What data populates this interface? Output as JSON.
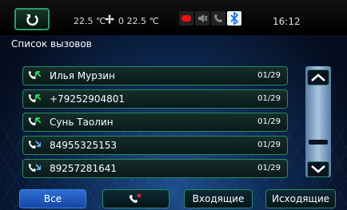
{
  "status": {
    "temp_left": "22.5 ℃",
    "temp_right": "0 22.5 ℃",
    "time": "16:12",
    "icons": [
      "media-icon",
      "mute-icon",
      "phone-status-icon",
      "bluetooth-icon"
    ]
  },
  "title": "Список вызовов",
  "calls": [
    {
      "name": "Илья Мурзин",
      "date": "01/29",
      "type": "incoming"
    },
    {
      "name": "+79252904801",
      "date": "01/29",
      "type": "incoming"
    },
    {
      "name": "Сунь Таолин",
      "date": "01/29",
      "type": "incoming"
    },
    {
      "name": "84955325153",
      "date": "01/29",
      "type": "outgoing"
    },
    {
      "name": "89257281641",
      "date": "01/29",
      "type": "outgoing"
    }
  ],
  "tabs": {
    "all": "Все",
    "incoming": "Входящие",
    "outgoing": "Исходящие"
  },
  "colors": {
    "accent": "#2a8a63",
    "active_tab": "#2e6fd4",
    "missed": "#e03030"
  }
}
